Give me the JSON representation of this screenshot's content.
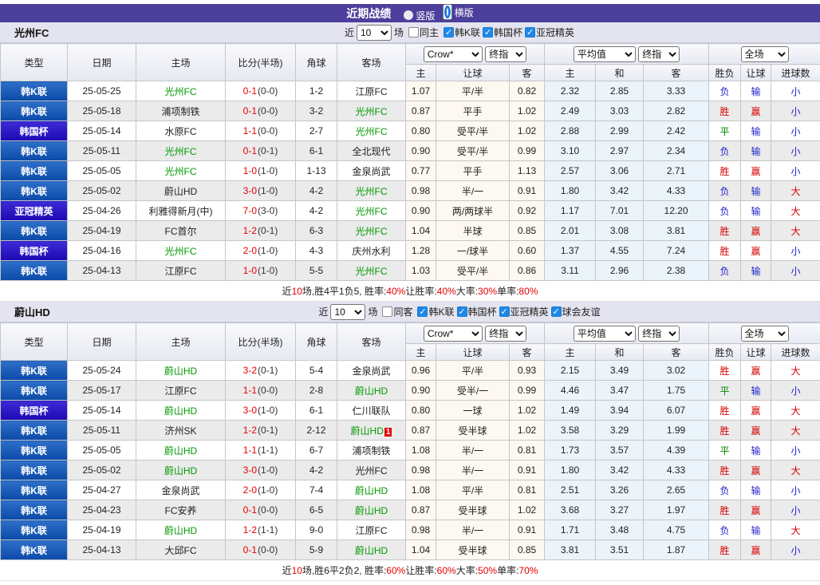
{
  "topbar": {
    "title": "近期战绩",
    "radios": [
      {
        "label": "竖版",
        "selected": false,
        "cls": ""
      },
      {
        "label": "横版",
        "selected": true,
        "cls": "sel"
      }
    ]
  },
  "colors": {
    "accent_purple": "#4c3f9c",
    "league_blue": "#0b4aa8",
    "cup_indigo": "#1c09b4",
    "win_red": "#d60000",
    "lose_blue": "#2323cc",
    "draw_green": "#008800",
    "team_green": "#009900",
    "score_red": "#e60000",
    "checkbox_blue": "#1e88e5"
  },
  "table_header": {
    "cols": {
      "type": "类型",
      "date": "日期",
      "home": "主场",
      "score": "比分(半场)",
      "corner": "角球",
      "away": "客场",
      "h": "主",
      "handicap": "让球",
      "a": "客",
      "avg_h": "主",
      "avg_d": "和",
      "avg_a": "客",
      "result": "胜负",
      "h_result": "让球",
      "goals": "进球数"
    },
    "selects": {
      "company": "Crow*",
      "final1": "终指",
      "average": "平均值",
      "final2": "终指",
      "fullmatch": "全场"
    }
  },
  "sections": [
    {
      "title": "光州FC",
      "filter": {
        "near": "近",
        "count": "10",
        "games": "场",
        "same": {
          "label": "同主",
          "checked": false
        },
        "leagues": [
          {
            "label": "韩K联",
            "checked": true,
            "cls": "on"
          },
          {
            "label": "韩国杯",
            "checked": true,
            "cls": "on"
          },
          {
            "label": "亚冠精英",
            "checked": true,
            "cls": "on"
          }
        ]
      },
      "rows": [
        {
          "league": "韩K联",
          "lg": "lg-k",
          "date": "25-05-25",
          "home": "光州FC",
          "home_cls": "hl",
          "ft": "0-1",
          "ht": "(0-0)",
          "corner": "1-2",
          "away": "江原FC",
          "away_cls": "",
          "badge": "",
          "o1": "1.07",
          "line": "平/半",
          "o2": "0.82",
          "ah": "2.32",
          "ad": "2.85",
          "aa": "3.33",
          "res": "负",
          "res_c": "b",
          "hr": "输",
          "hr_c": "b",
          "gl": "小",
          "gl_c": "b"
        },
        {
          "league": "韩K联",
          "lg": "lg-k",
          "date": "25-05-18",
          "home": "浦项制铁",
          "home_cls": "",
          "ft": "0-1",
          "ht": "(0-0)",
          "corner": "3-2",
          "away": "光州FC",
          "away_cls": "hl",
          "badge": "",
          "o1": "0.87",
          "line": "平手",
          "o2": "1.02",
          "ah": "2.49",
          "ad": "3.03",
          "aa": "2.82",
          "res": "胜",
          "res_c": "r",
          "hr": "赢",
          "hr_c": "r",
          "gl": "小",
          "gl_c": "b"
        },
        {
          "league": "韩国杯",
          "lg": "lg-cup",
          "date": "25-05-14",
          "home": "水原FC",
          "home_cls": "",
          "ft": "1-1",
          "ht": "(0-0)",
          "corner": "2-7",
          "away": "光州FC",
          "away_cls": "hl",
          "badge": "",
          "o1": "0.80",
          "line": "受平/半",
          "o2": "1.02",
          "ah": "2.88",
          "ad": "2.99",
          "aa": "2.42",
          "res": "平",
          "res_c": "g",
          "hr": "输",
          "hr_c": "b",
          "gl": "小",
          "gl_c": "b"
        },
        {
          "league": "韩K联",
          "lg": "lg-k",
          "date": "25-05-11",
          "home": "光州FC",
          "home_cls": "hl",
          "ft": "0-1",
          "ht": "(0-1)",
          "corner": "6-1",
          "away": "全北现代",
          "away_cls": "",
          "badge": "",
          "o1": "0.90",
          "line": "受平/半",
          "o2": "0.99",
          "ah": "3.10",
          "ad": "2.97",
          "aa": "2.34",
          "res": "负",
          "res_c": "b",
          "hr": "输",
          "hr_c": "b",
          "gl": "小",
          "gl_c": "b"
        },
        {
          "league": "韩K联",
          "lg": "lg-k",
          "date": "25-05-05",
          "home": "光州FC",
          "home_cls": "hl",
          "ft": "1-0",
          "ht": "(1-0)",
          "corner": "1-13",
          "away": "金泉尚武",
          "away_cls": "",
          "badge": "",
          "o1": "0.77",
          "line": "平手",
          "o2": "1.13",
          "ah": "2.57",
          "ad": "3.06",
          "aa": "2.71",
          "res": "胜",
          "res_c": "r",
          "hr": "赢",
          "hr_c": "r",
          "gl": "小",
          "gl_c": "b"
        },
        {
          "league": "韩K联",
          "lg": "lg-k",
          "date": "25-05-02",
          "home": "蔚山HD",
          "home_cls": "",
          "ft": "3-0",
          "ht": "(1-0)",
          "corner": "4-2",
          "away": "光州FC",
          "away_cls": "hl",
          "badge": "",
          "o1": "0.98",
          "line": "半/一",
          "o2": "0.91",
          "ah": "1.80",
          "ad": "3.42",
          "aa": "4.33",
          "res": "负",
          "res_c": "b",
          "hr": "输",
          "hr_c": "b",
          "gl": "大",
          "gl_c": "r"
        },
        {
          "league": "亚冠精英",
          "lg": "lg-cup",
          "date": "25-04-26",
          "home": "利雅得新月(中)",
          "home_cls": "",
          "ft": "7-0",
          "ht": "(3-0)",
          "corner": "4-2",
          "away": "光州FC",
          "away_cls": "hl",
          "badge": "",
          "o1": "0.90",
          "line": "两/两球半",
          "o2": "0.92",
          "ah": "1.17",
          "ad": "7.01",
          "aa": "12.20",
          "res": "负",
          "res_c": "b",
          "hr": "输",
          "hr_c": "b",
          "gl": "大",
          "gl_c": "r"
        },
        {
          "league": "韩K联",
          "lg": "lg-k",
          "date": "25-04-19",
          "home": "FC首尔",
          "home_cls": "",
          "ft": "1-2",
          "ht": "(0-1)",
          "corner": "6-3",
          "away": "光州FC",
          "away_cls": "hl",
          "badge": "",
          "o1": "1.04",
          "line": "半球",
          "o2": "0.85",
          "ah": "2.01",
          "ad": "3.08",
          "aa": "3.81",
          "res": "胜",
          "res_c": "r",
          "hr": "赢",
          "hr_c": "r",
          "gl": "大",
          "gl_c": "r"
        },
        {
          "league": "韩国杯",
          "lg": "lg-cup",
          "date": "25-04-16",
          "home": "光州FC",
          "home_cls": "hl",
          "ft": "2-0",
          "ht": "(1-0)",
          "corner": "4-3",
          "away": "庆州水利",
          "away_cls": "",
          "badge": "",
          "o1": "1.28",
          "line": "一/球半",
          "o2": "0.60",
          "ah": "1.37",
          "ad": "4.55",
          "aa": "7.24",
          "res": "胜",
          "res_c": "r",
          "hr": "赢",
          "hr_c": "r",
          "gl": "小",
          "gl_c": "b"
        },
        {
          "league": "韩K联",
          "lg": "lg-k",
          "date": "25-04-13",
          "home": "江原FC",
          "home_cls": "",
          "ft": "1-0",
          "ht": "(1-0)",
          "corner": "5-5",
          "away": "光州FC",
          "away_cls": "hl",
          "badge": "",
          "o1": "1.03",
          "line": "受平/半",
          "o2": "0.86",
          "ah": "3.11",
          "ad": "2.96",
          "aa": "2.38",
          "res": "负",
          "res_c": "b",
          "hr": "输",
          "hr_c": "b",
          "gl": "小",
          "gl_c": "b"
        }
      ],
      "summary": [
        {
          "t": "近",
          "c": ""
        },
        {
          "t": "10",
          "c": "red"
        },
        {
          "t": "场,胜4平1负5, 胜率:",
          "c": ""
        },
        {
          "t": "40%",
          "c": "red"
        },
        {
          "t": " 让胜率:",
          "c": ""
        },
        {
          "t": "40%",
          "c": "red"
        },
        {
          "t": " 大率:",
          "c": ""
        },
        {
          "t": "30%",
          "c": "red"
        },
        {
          "t": " 单率:",
          "c": ""
        },
        {
          "t": "80%",
          "c": "red"
        }
      ]
    },
    {
      "title": "蔚山HD",
      "filter": {
        "near": "近",
        "count": "10",
        "games": "场",
        "same": {
          "label": "同客",
          "checked": false
        },
        "leagues": [
          {
            "label": "韩K联",
            "checked": true,
            "cls": "on"
          },
          {
            "label": "韩国杯",
            "checked": true,
            "cls": "on"
          },
          {
            "label": "亚冠精英",
            "checked": true,
            "cls": "on"
          },
          {
            "label": "球会友谊",
            "checked": true,
            "cls": "on"
          }
        ]
      },
      "rows": [
        {
          "league": "韩K联",
          "lg": "lg-k",
          "date": "25-05-24",
          "home": "蔚山HD",
          "home_cls": "hl",
          "ft": "3-2",
          "ht": "(0-1)",
          "corner": "5-4",
          "away": "金泉尚武",
          "away_cls": "",
          "badge": "",
          "o1": "0.96",
          "line": "平/半",
          "o2": "0.93",
          "ah": "2.15",
          "ad": "3.49",
          "aa": "3.02",
          "res": "胜",
          "res_c": "r",
          "hr": "赢",
          "hr_c": "r",
          "gl": "大",
          "gl_c": "r"
        },
        {
          "league": "韩K联",
          "lg": "lg-k",
          "date": "25-05-17",
          "home": "江原FC",
          "home_cls": "",
          "ft": "1-1",
          "ht": "(0-0)",
          "corner": "2-8",
          "away": "蔚山HD",
          "away_cls": "hl",
          "badge": "",
          "o1": "0.90",
          "line": "受半/一",
          "o2": "0.99",
          "ah": "4.46",
          "ad": "3.47",
          "aa": "1.75",
          "res": "平",
          "res_c": "g",
          "hr": "输",
          "hr_c": "b",
          "gl": "小",
          "gl_c": "b"
        },
        {
          "league": "韩国杯",
          "lg": "lg-cup",
          "date": "25-05-14",
          "home": "蔚山HD",
          "home_cls": "hl",
          "ft": "3-0",
          "ht": "(1-0)",
          "corner": "6-1",
          "away": "仁川联队",
          "away_cls": "",
          "badge": "",
          "o1": "0.80",
          "line": "一球",
          "o2": "1.02",
          "ah": "1.49",
          "ad": "3.94",
          "aa": "6.07",
          "res": "胜",
          "res_c": "r",
          "hr": "赢",
          "hr_c": "r",
          "gl": "大",
          "gl_c": "r"
        },
        {
          "league": "韩K联",
          "lg": "lg-k",
          "date": "25-05-11",
          "home": "济州SK",
          "home_cls": "",
          "ft": "1-2",
          "ht": "(0-1)",
          "corner": "2-12",
          "away": "蔚山HD",
          "away_cls": "hl",
          "badge": "1",
          "o1": "0.87",
          "line": "受半球",
          "o2": "1.02",
          "ah": "3.58",
          "ad": "3.29",
          "aa": "1.99",
          "res": "胜",
          "res_c": "r",
          "hr": "赢",
          "hr_c": "r",
          "gl": "大",
          "gl_c": "r"
        },
        {
          "league": "韩K联",
          "lg": "lg-k",
          "date": "25-05-05",
          "home": "蔚山HD",
          "home_cls": "hl",
          "ft": "1-1",
          "ht": "(1-1)",
          "corner": "6-7",
          "away": "浦项制铁",
          "away_cls": "",
          "badge": "",
          "o1": "1.08",
          "line": "半/一",
          "o2": "0.81",
          "ah": "1.73",
          "ad": "3.57",
          "aa": "4.39",
          "res": "平",
          "res_c": "g",
          "hr": "输",
          "hr_c": "b",
          "gl": "小",
          "gl_c": "b"
        },
        {
          "league": "韩K联",
          "lg": "lg-k",
          "date": "25-05-02",
          "home": "蔚山HD",
          "home_cls": "hl",
          "ft": "3-0",
          "ht": "(1-0)",
          "corner": "4-2",
          "away": "光州FC",
          "away_cls": "",
          "badge": "",
          "o1": "0.98",
          "line": "半/一",
          "o2": "0.91",
          "ah": "1.80",
          "ad": "3.42",
          "aa": "4.33",
          "res": "胜",
          "res_c": "r",
          "hr": "赢",
          "hr_c": "r",
          "gl": "大",
          "gl_c": "r"
        },
        {
          "league": "韩K联",
          "lg": "lg-k",
          "date": "25-04-27",
          "home": "金泉尚武",
          "home_cls": "",
          "ft": "2-0",
          "ht": "(1-0)",
          "corner": "7-4",
          "away": "蔚山HD",
          "away_cls": "hl",
          "badge": "",
          "o1": "1.08",
          "line": "平/半",
          "o2": "0.81",
          "ah": "2.51",
          "ad": "3.26",
          "aa": "2.65",
          "res": "负",
          "res_c": "b",
          "hr": "输",
          "hr_c": "b",
          "gl": "小",
          "gl_c": "b"
        },
        {
          "league": "韩K联",
          "lg": "lg-k",
          "date": "25-04-23",
          "home": "FC安养",
          "home_cls": "",
          "ft": "0-1",
          "ht": "(0-0)",
          "corner": "6-5",
          "away": "蔚山HD",
          "away_cls": "hl",
          "badge": "",
          "o1": "0.87",
          "line": "受半球",
          "o2": "1.02",
          "ah": "3.68",
          "ad": "3.27",
          "aa": "1.97",
          "res": "胜",
          "res_c": "r",
          "hr": "赢",
          "hr_c": "r",
          "gl": "小",
          "gl_c": "b"
        },
        {
          "league": "韩K联",
          "lg": "lg-k",
          "date": "25-04-19",
          "home": "蔚山HD",
          "home_cls": "hl",
          "ft": "1-2",
          "ht": "(1-1)",
          "corner": "9-0",
          "away": "江原FC",
          "away_cls": "",
          "badge": "",
          "o1": "0.98",
          "line": "半/一",
          "o2": "0.91",
          "ah": "1.71",
          "ad": "3.48",
          "aa": "4.75",
          "res": "负",
          "res_c": "b",
          "hr": "输",
          "hr_c": "b",
          "gl": "大",
          "gl_c": "r"
        },
        {
          "league": "韩K联",
          "lg": "lg-k",
          "date": "25-04-13",
          "home": "大邱FC",
          "home_cls": "",
          "ft": "0-1",
          "ht": "(0-0)",
          "corner": "5-9",
          "away": "蔚山HD",
          "away_cls": "hl",
          "badge": "",
          "o1": "1.04",
          "line": "受半球",
          "o2": "0.85",
          "ah": "3.81",
          "ad": "3.51",
          "aa": "1.87",
          "res": "胜",
          "res_c": "r",
          "hr": "赢",
          "hr_c": "r",
          "gl": "小",
          "gl_c": "b"
        }
      ],
      "summary": [
        {
          "t": "近",
          "c": ""
        },
        {
          "t": "10",
          "c": "red"
        },
        {
          "t": "场,胜6平2负2, 胜率:",
          "c": ""
        },
        {
          "t": "60%",
          "c": "red"
        },
        {
          "t": " 让胜率:",
          "c": ""
        },
        {
          "t": "60%",
          "c": "red"
        },
        {
          "t": " 大率:",
          "c": ""
        },
        {
          "t": "50%",
          "c": "red"
        },
        {
          "t": " 单率:",
          "c": ""
        },
        {
          "t": "70%",
          "c": "red"
        }
      ]
    }
  ]
}
